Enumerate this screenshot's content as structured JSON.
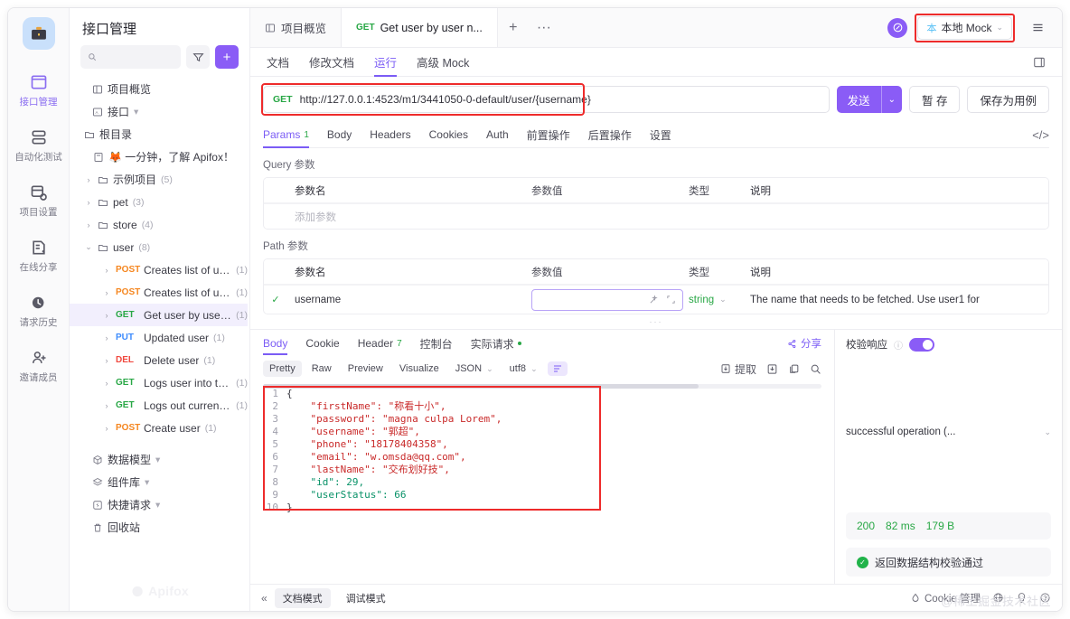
{
  "rail": {
    "logo_icon": "briefcase-icon",
    "items": [
      {
        "label": "接口管理",
        "icon": "api-manage-icon",
        "active": true
      },
      {
        "label": "自动化测试",
        "icon": "automation-test-icon",
        "active": false
      },
      {
        "label": "项目设置",
        "icon": "project-settings-icon",
        "active": false
      },
      {
        "label": "在线分享",
        "icon": "online-share-icon",
        "active": false
      },
      {
        "label": "请求历史",
        "icon": "request-history-icon",
        "active": false
      },
      {
        "label": "邀请成员",
        "icon": "invite-member-icon",
        "active": false
      }
    ]
  },
  "sidebar": {
    "title": "接口管理",
    "search_placeholder": "",
    "search_value": "",
    "filter_icon": "filter-icon",
    "add_label": "+",
    "watermark": "Apifox",
    "tree": [
      {
        "label": "项目概览",
        "icon": "overview-icon",
        "indent": 0,
        "caret": "",
        "count": "",
        "method": ""
      },
      {
        "label": "接口",
        "icon": "api-icon",
        "indent": 0,
        "caret": "",
        "count": "",
        "method": "",
        "trail": "▾"
      },
      {
        "label": "根目录",
        "icon": "folder-icon",
        "indent": 1,
        "caret": "",
        "count": "",
        "method": ""
      },
      {
        "label": "🦊 一分钟，了解 Apifox！",
        "icon": "doc-icon",
        "indent": 2,
        "caret": "",
        "count": "",
        "method": ""
      },
      {
        "label": "示例项目",
        "icon": "folder-icon",
        "indent": 1,
        "caret": "›",
        "count": "(5)",
        "method": ""
      },
      {
        "label": "pet",
        "icon": "folder-icon",
        "indent": 1,
        "caret": "›",
        "count": "(3)",
        "method": ""
      },
      {
        "label": "store",
        "icon": "folder-icon",
        "indent": 1,
        "caret": "›",
        "count": "(4)",
        "method": ""
      },
      {
        "label": "user",
        "icon": "folder-icon",
        "indent": 1,
        "caret": "⌄",
        "count": "(8)",
        "method": ""
      },
      {
        "label": "Creates list of use...",
        "icon": "",
        "indent": 2,
        "caret": "›",
        "count": "(1)",
        "method": "POST",
        "mclass": "m-post"
      },
      {
        "label": "Creates list of use...",
        "icon": "",
        "indent": 2,
        "caret": "›",
        "count": "(1)",
        "method": "POST",
        "mclass": "m-post"
      },
      {
        "label": "Get user by user ...",
        "icon": "",
        "indent": 2,
        "caret": "›",
        "count": "(1)",
        "method": "GET",
        "mclass": "m-get",
        "selected": true
      },
      {
        "label": "Updated user",
        "icon": "",
        "indent": 2,
        "caret": "›",
        "count": "(1)",
        "method": "PUT",
        "mclass": "m-put"
      },
      {
        "label": "Delete user",
        "icon": "",
        "indent": 2,
        "caret": "›",
        "count": "(1)",
        "method": "DEL",
        "mclass": "m-del"
      },
      {
        "label": "Logs user into the...",
        "icon": "",
        "indent": 2,
        "caret": "›",
        "count": "(1)",
        "method": "GET",
        "mclass": "m-get"
      },
      {
        "label": "Logs out current l...",
        "icon": "",
        "indent": 2,
        "caret": "›",
        "count": "(1)",
        "method": "GET",
        "mclass": "m-get"
      },
      {
        "label": "Create user",
        "icon": "",
        "indent": 2,
        "caret": "›",
        "count": "(1)",
        "method": "POST",
        "mclass": "m-post"
      }
    ],
    "bottom_items": [
      {
        "label": "数据模型",
        "icon": "data-model-icon",
        "trail": "▾"
      },
      {
        "label": "组件库",
        "icon": "component-library-icon",
        "trail": "▾"
      },
      {
        "label": "快捷请求",
        "icon": "quick-request-icon",
        "trail": "▾"
      },
      {
        "label": "回收站",
        "icon": "trash-icon",
        "trail": ""
      }
    ]
  },
  "topbar": {
    "tabs": [
      {
        "label": "项目概览",
        "method": "",
        "icon": "overview-icon",
        "active": false
      },
      {
        "label": "Get user by user n...",
        "method": "GET",
        "icon": "",
        "active": true
      }
    ],
    "new_tab_label": "+",
    "more_label": "···",
    "sync_icon": "sync-circle-icon",
    "env_mark": "本",
    "env_label": "本地 Mock",
    "env_caret": "⌄",
    "menu_icon": "hamburger-menu-icon"
  },
  "subtabs": {
    "items": [
      {
        "label": "文档",
        "active": false
      },
      {
        "label": "修改文档",
        "active": false
      },
      {
        "label": "运行",
        "active": true
      },
      {
        "label": "高级 Mock",
        "active": false
      }
    ],
    "right_icon": "layout-panel-icon"
  },
  "request": {
    "method": "GET",
    "url": "http://127.0.0.1:4523/m1/3441050-0-default/user/{username}",
    "send_label": "发送",
    "send_caret": "⌄",
    "save_draft_label": "暂 存",
    "save_case_label": "保存为用例",
    "param_tabs": [
      {
        "label": "Params",
        "badge": "1",
        "active": true
      },
      {
        "label": "Body",
        "badge": "",
        "active": false
      },
      {
        "label": "Headers",
        "badge": "",
        "active": false
      },
      {
        "label": "Cookies",
        "badge": "",
        "active": false
      },
      {
        "label": "Auth",
        "badge": "",
        "active": false
      },
      {
        "label": "前置操作",
        "badge": "",
        "active": false
      },
      {
        "label": "后置操作",
        "badge": "",
        "active": false
      },
      {
        "label": "设置",
        "badge": "",
        "active": false
      }
    ],
    "code_icon": "code-brackets-icon",
    "query": {
      "section_label": "Query 参数",
      "headers": [
        "参数名",
        "参数值",
        "类型",
        "说明"
      ],
      "empty_placeholder": "添加参数"
    },
    "path": {
      "section_label": "Path 参数",
      "headers": [
        "参数名",
        "参数值",
        "类型",
        "说明"
      ],
      "rows": [
        {
          "checked": "✓",
          "name": "username",
          "value": "",
          "type": "string",
          "desc": "The name that needs to be fetched. Use user1 for",
          "magic_icon": "magic-wand-icon",
          "expand_icon": "expand-icon"
        }
      ]
    }
  },
  "response": {
    "tabs": [
      {
        "label": "Body",
        "badge": "",
        "active": true,
        "dot": false
      },
      {
        "label": "Cookie",
        "badge": "",
        "active": false,
        "dot": false
      },
      {
        "label": "Header",
        "badge": "7",
        "active": false,
        "dot": false
      },
      {
        "label": "控制台",
        "badge": "",
        "active": false,
        "dot": false
      },
      {
        "label": "实际请求",
        "badge": "",
        "active": false,
        "dot": true
      }
    ],
    "share_label": "分享",
    "share_icon": "share-icon",
    "tools": [
      {
        "label": "Pretty",
        "on": true,
        "caret": ""
      },
      {
        "label": "Raw",
        "on": false,
        "caret": ""
      },
      {
        "label": "Preview",
        "on": false,
        "caret": ""
      },
      {
        "label": "Visualize",
        "on": false,
        "caret": ""
      },
      {
        "label": "JSON",
        "on": false,
        "caret": "⌄"
      },
      {
        "label": "utf8",
        "on": false,
        "caret": "⌄"
      }
    ],
    "wrap_icon": "word-wrap-icon",
    "extract_label": "提取",
    "extract_icon": "extract-icon",
    "download_icon": "download-icon",
    "copy_icon": "copy-icon",
    "search_icon": "search-icon",
    "code_lines": [
      {
        "n": "1",
        "text": "{"
      },
      {
        "n": "2",
        "text": "    \"firstName\": \"称看十小\","
      },
      {
        "n": "3",
        "text": "    \"password\": \"magna culpa Lorem\","
      },
      {
        "n": "4",
        "text": "    \"username\": \"郭超\","
      },
      {
        "n": "5",
        "text": "    \"phone\": \"18178404358\","
      },
      {
        "n": "6",
        "text": "    \"email\": \"w.omsda@qq.com\","
      },
      {
        "n": "7",
        "text": "    \"lastName\": \"交布划好技\","
      },
      {
        "n": "8",
        "text": "    \"id\": 29,"
      },
      {
        "n": "9",
        "text": "    \"userStatus\": 66"
      },
      {
        "n": "10",
        "text": "}"
      }
    ],
    "validate": {
      "label": "校验响应",
      "help_icon": "question-icon",
      "toggle_on": true,
      "selected_schema": "successful operation (...",
      "caret": "⌄",
      "status_code": "200",
      "time": "82 ms",
      "size": "179 B",
      "result_icon": "check-circle-icon",
      "result_text": "返回数据结构校验通过"
    }
  },
  "footer": {
    "collapse_icon": "collapse-left-icon",
    "modes": [
      {
        "label": "文档模式",
        "on": true
      },
      {
        "label": "调试模式",
        "on": false
      }
    ],
    "cookie_label": "Cookie 管理",
    "cookie_icon": "cookie-icon",
    "globe_icon": "globe-icon",
    "bulb_icon": "bulb-icon",
    "help_icon": "help-circle-icon",
    "watermark": "@稀土掘金技术社区"
  }
}
